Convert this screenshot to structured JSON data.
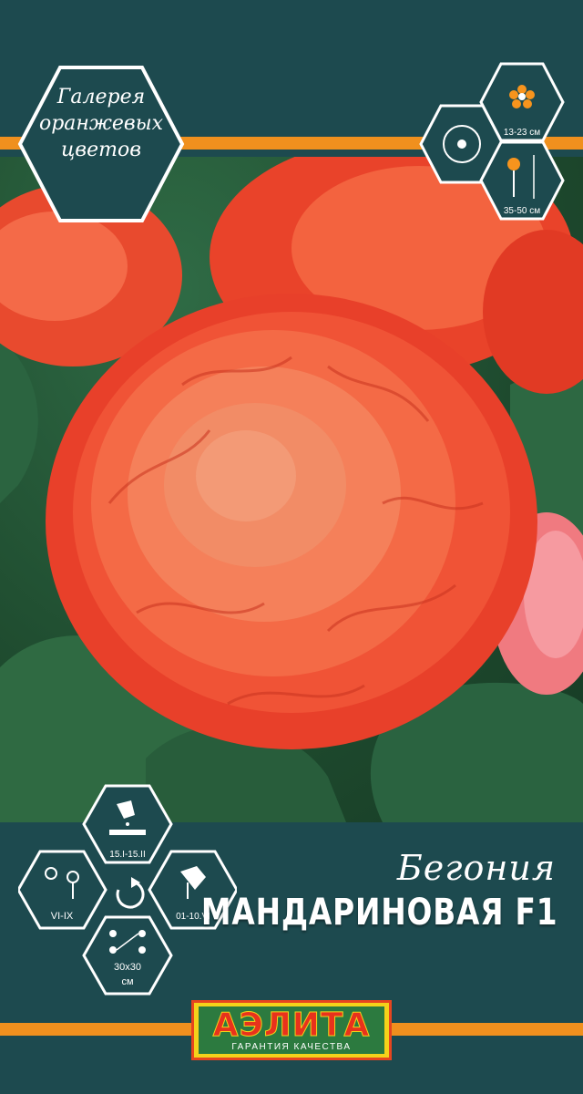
{
  "gallery_badge": {
    "lines": [
      "Галерея",
      "оранжевых",
      "цветов"
    ]
  },
  "size_icons": {
    "flower_diameter": "13-23 см",
    "plant_height": "35-50 см"
  },
  "product": {
    "species": "Бегония",
    "variety": "МАНДАРИНОВАЯ F1"
  },
  "growing_icons": {
    "sowing_period": "15.I-15.II",
    "planting_period": "01-10.VI",
    "flowering_period": "VI-IX",
    "spacing_line1": "30x30",
    "spacing_line2": "см"
  },
  "brand": {
    "name": "АЭЛИТА",
    "tagline": "ГАРАНТИЯ КАЧЕСТВА"
  },
  "colors": {
    "background": "#1d4a4f",
    "accent_stripe": "#f0901e",
    "logo_yellow": "#f4d21a",
    "logo_green": "#2c7a3f",
    "logo_red": "#e8321c"
  }
}
